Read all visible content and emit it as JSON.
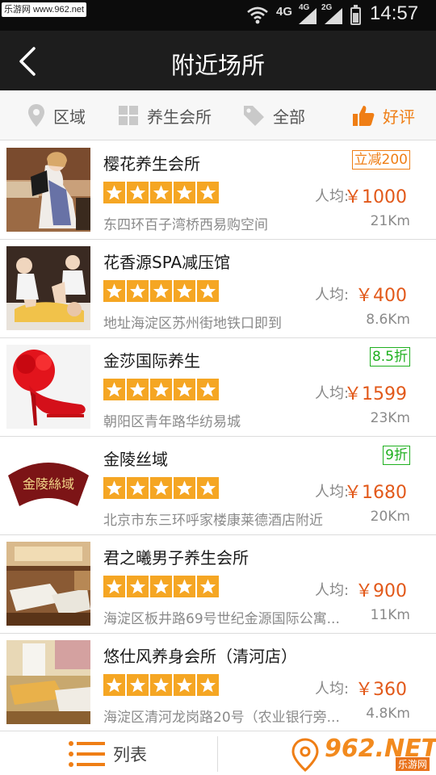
{
  "status_bar": {
    "watermark": "乐游网 www.962.net",
    "network_a": "4G",
    "network_b": "4G",
    "network_c": "2G",
    "time": "14:57"
  },
  "header": {
    "title": "附近场所"
  },
  "filters": [
    {
      "label": "区域",
      "icon": "location-pin-icon"
    },
    {
      "label": "养生会所",
      "icon": "grid-icon"
    },
    {
      "label": "全部",
      "icon": "tag-icon"
    },
    {
      "label": "好评",
      "icon": "thumbs-up-icon"
    }
  ],
  "price_prefix": "人均:",
  "items": [
    {
      "name": "樱花养生会所",
      "badge": "立减200",
      "badge_color": "#ef7e15",
      "rating": 5,
      "price": "￥1000",
      "address": "东四环百子湾桥西易购空间",
      "distance": "21Km"
    },
    {
      "name": "花香源SPA减压馆",
      "badge": "",
      "rating": 5,
      "price": "￥400",
      "address": "地址海淀区苏州街地铁口即到",
      "distance": "8.6Km"
    },
    {
      "name": "金莎国际养生",
      "badge": "8.5折",
      "badge_color": "#1fb01f",
      "rating": 5,
      "price": "￥1599",
      "address": "朝阳区青年路华纺易城",
      "distance": "23Km"
    },
    {
      "name": "金陵丝域",
      "badge": "9折",
      "badge_color": "#1fb01f",
      "rating": 5,
      "price": "￥1680",
      "address": "北京市东三环呼家楼康莱德酒店附近",
      "distance": "20Km",
      "thumb_text": "金陵絲域"
    },
    {
      "name": "君之曦男子养生会所",
      "badge": "",
      "rating": 5,
      "price": "￥900",
      "address": "海淀区板井路69号世纪金源国际公寓...",
      "distance": "11Km"
    },
    {
      "name": "悠仕风养身会所（清河店）",
      "badge": "",
      "rating": 5,
      "price": "￥360",
      "address": "海淀区清河龙岗路20号（农业银行旁...",
      "distance": "4.8Km"
    }
  ],
  "bottom_bar": {
    "list_label": "列表",
    "list_icon": "list-icon",
    "map_icon": "map-pin-icon"
  },
  "watermark_logo": {
    "main": "962.NET",
    "sub": "乐游网"
  }
}
